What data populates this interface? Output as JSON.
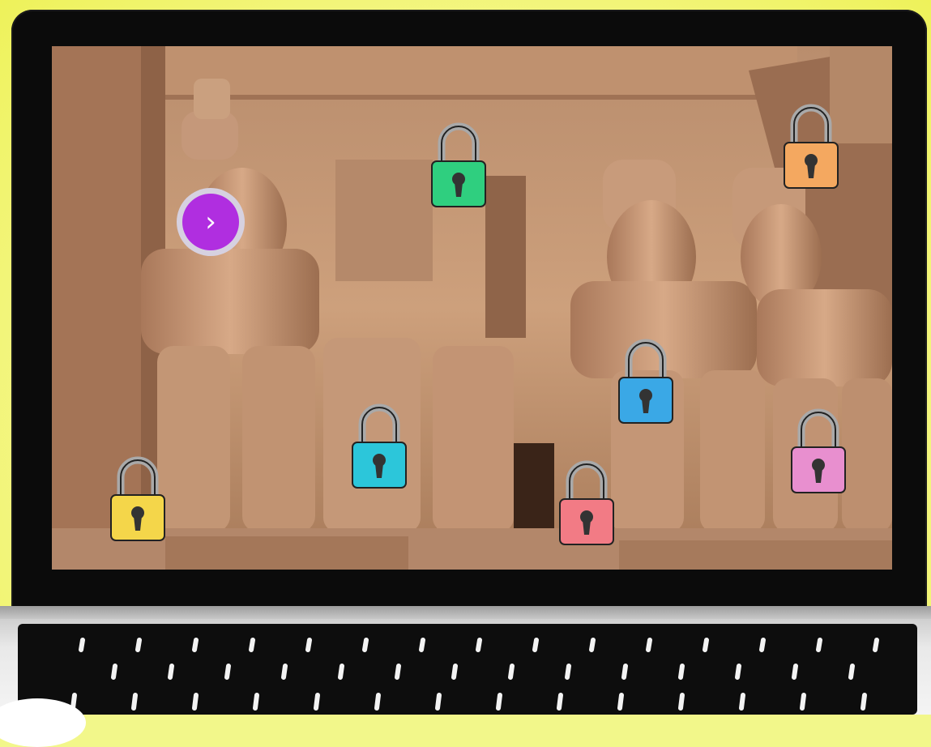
{
  "scene": {
    "background": "abu-simbel-temple-facade",
    "stage_color": "#f2f78a"
  },
  "next_button": {
    "icon": "chevron-right-icon",
    "glyph": "›",
    "color": "#b02ee0"
  },
  "locks": [
    {
      "id": "lock-green",
      "color": "#2fcf7f",
      "icon": "padlock-icon",
      "locked": true
    },
    {
      "id": "lock-orange",
      "color": "#f4a860",
      "icon": "padlock-icon",
      "locked": true
    },
    {
      "id": "lock-blue",
      "color": "#3aa8e6",
      "icon": "padlock-icon",
      "locked": true
    },
    {
      "id": "lock-cyan",
      "color": "#2cc6da",
      "icon": "padlock-icon",
      "locked": true
    },
    {
      "id": "lock-pink",
      "color": "#e88fcf",
      "icon": "padlock-icon",
      "locked": true
    },
    {
      "id": "lock-red",
      "color": "#f27b85",
      "icon": "padlock-icon",
      "locked": true
    },
    {
      "id": "lock-yellow",
      "color": "#f4d64a",
      "icon": "padlock-icon",
      "locked": true
    }
  ]
}
